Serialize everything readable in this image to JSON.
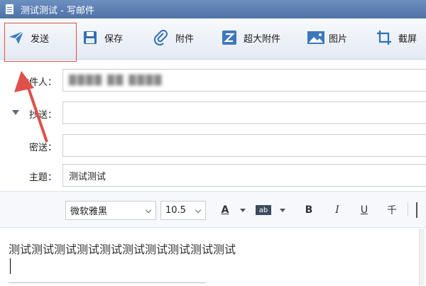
{
  "window": {
    "title": "测试测试 - 写邮件"
  },
  "toolbar": {
    "send_label": "发送",
    "save_label": "保存",
    "attach_label": "附件",
    "big_attach_label": "超大附件",
    "image_label": "图片",
    "screenshot_label": "截屏",
    "icons": {
      "send": "paper-plane-icon",
      "save": "floppy-disk-icon",
      "attach": "paperclip-icon",
      "big_attach": "z-box-icon",
      "image": "picture-icon",
      "screenshot": "crop-icon"
    }
  },
  "fields": {
    "to_label": "收件人：",
    "to_value": "████ ██ ████",
    "cc_label": "抄送：",
    "cc_value": "",
    "bcc_label": "密送：",
    "bcc_value": "",
    "subject_label": "主题：",
    "subject_value": "测试测试"
  },
  "format": {
    "font": "微软雅黑",
    "size": "10.5",
    "font_color_label": "A",
    "highlight_label": "ab",
    "bold_label": "B",
    "italic_label": "I",
    "underline_label": "U",
    "strike_label": "千"
  },
  "body": {
    "text": "测试测试测试测试测试测试测试测试测试测试"
  },
  "colors": {
    "titlebar": "#5779ad",
    "annotation": "#e0504a",
    "send_icon": "#3c7fc2"
  }
}
